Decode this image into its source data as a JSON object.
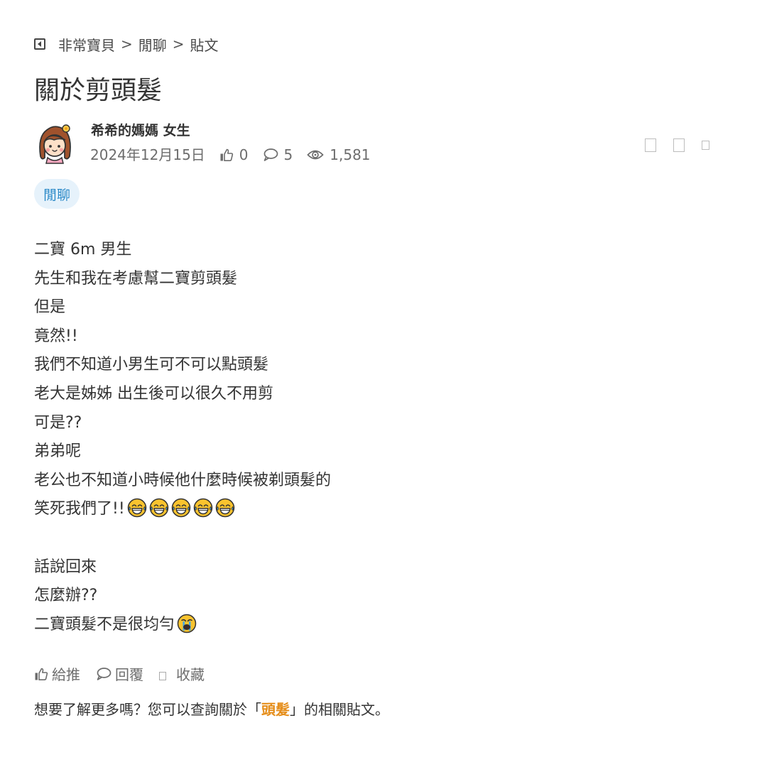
{
  "breadcrumb": {
    "items": [
      "非常寶貝",
      "閒聊",
      "貼文"
    ],
    "separator": ">"
  },
  "post": {
    "title": "關於剪頭髮",
    "author": "希希的媽媽 女生",
    "date": "2024年12月15日",
    "likes": "0",
    "comments": "5",
    "views": "1,581",
    "tag": "閒聊",
    "body_lines": [
      "二寶 6m 男生",
      "先生和我在考慮幫二寶剪頭髮",
      "但是",
      "竟然!!",
      "我們不知道小男生可不可以點頭髮",
      "老大是姊姊 出生後可以很久不用剪",
      "可是??",
      "弟弟呢",
      "老公也不知道小時候他什麼時候被剃頭髮的",
      "笑死我們了!!",
      "",
      "話說回來",
      "怎麼辦??",
      "二寶頭髮不是很均勻"
    ]
  },
  "actions": {
    "like_label": "給推",
    "reply_label": "回覆",
    "favorite_label": "收藏"
  },
  "related": {
    "prefix": "想要了解更多嗎？您可以查詢關於「",
    "keyword": "頭髮",
    "suffix": "」的相關貼文。"
  },
  "colors": {
    "tag_bg": "#e6f2fb",
    "tag_text": "#2c8ac8",
    "keyword": "#e58d19",
    "meta": "#6d6d6d"
  },
  "icons": [
    "back-icon",
    "thumbs-up-icon",
    "comment-icon",
    "eye-icon",
    "laughing-tears-emoji",
    "crying-emoji"
  ]
}
